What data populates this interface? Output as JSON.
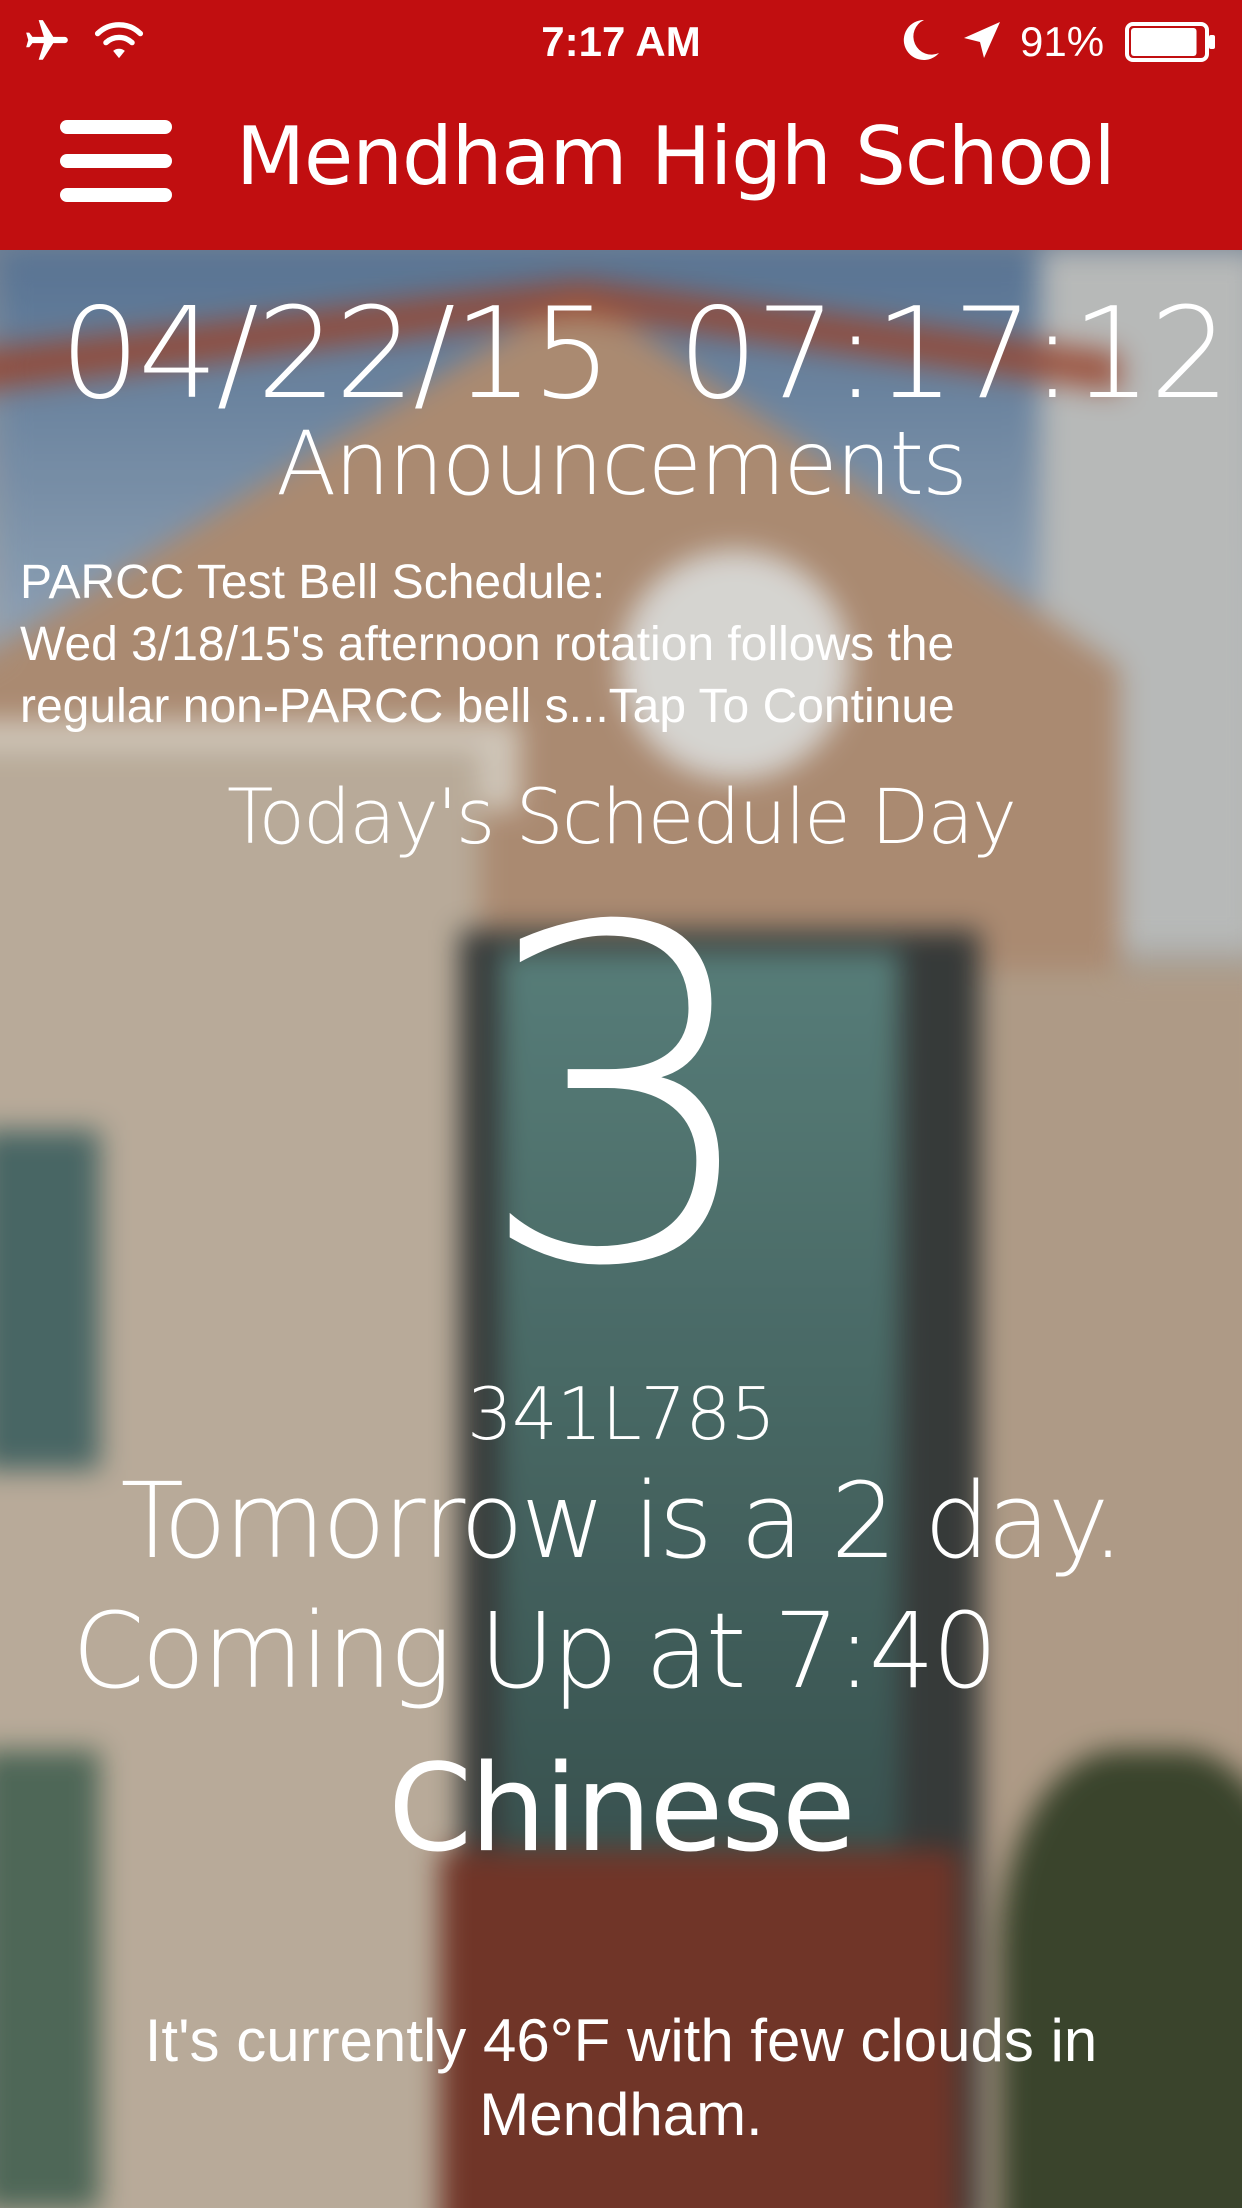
{
  "status_bar": {
    "time": "7:17 AM",
    "battery_percent": "91%",
    "battery_level": 0.91,
    "icons": [
      "airplane-icon",
      "wifi-icon",
      "moon-icon",
      "location-arrow-icon",
      "battery-icon"
    ]
  },
  "nav": {
    "title": "Mendham High School",
    "menu_icon": "hamburger-menu-icon"
  },
  "datetime": {
    "date": "04/22/15",
    "time": "07:17:12"
  },
  "announcements": {
    "heading": "Announcements",
    "line1": "PARCC Test Bell Schedule:",
    "line2": "Wed 3/18/15's afternoon rotation follows the",
    "line3": "regular non-PARCC bell s...Tap To Continue"
  },
  "schedule": {
    "heading": "Today's Schedule Day",
    "day_number": "3",
    "day_code": "341L785",
    "tomorrow": "Tomorrow is a 2 day.",
    "coming_up": "Coming Up at 7:40",
    "next_class": "Chinese"
  },
  "weather": {
    "line1": "It's currently 46°F with few clouds in",
    "line2": "Mendham."
  },
  "colors": {
    "brand_red": "#c10e10",
    "text": "#ffffff"
  }
}
